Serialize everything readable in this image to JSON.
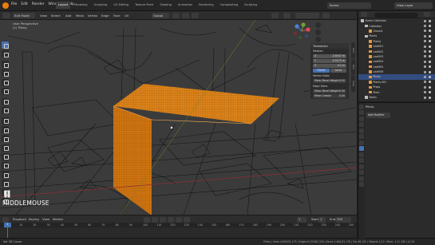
{
  "topbar": {
    "menus": [
      "File",
      "Edit",
      "Render",
      "Window",
      "Help"
    ],
    "tabs": [
      "Layout",
      "Modeling",
      "Sculpting",
      "UV Editing",
      "Texture Paint",
      "Shading",
      "Animation",
      "Rendering",
      "Compositing",
      "Scripting"
    ],
    "active_tab": "Layout",
    "scene_name": "Scene",
    "view_layer": "View Layer"
  },
  "viewport_header": {
    "mode": "Edit Mode",
    "menus": [
      "View",
      "Select",
      "Add",
      "Mesh",
      "Vertex",
      "Edge",
      "Face",
      "UV"
    ],
    "orientation": "Global",
    "view_title": "User Perspective",
    "object_name": "(1) Plinky"
  },
  "npanel": {
    "title": "Transform",
    "subtitle": "Median:",
    "rows": [
      {
        "label": "X",
        "value": "-0.6547 m"
      },
      {
        "label": "Y",
        "value": "-0.5275 m"
      },
      {
        "label": "Z",
        "value": "0.2 m"
      }
    ],
    "global_local": [
      "Global",
      "Local"
    ],
    "vertex_data": "Vertex Data:",
    "vertex_rows": [
      {
        "label": "Mean Bevel Weight",
        "value": "0.00"
      }
    ],
    "edge_data": "Edge Data:",
    "edge_rows": [
      {
        "label": "Mean Bevel Weight",
        "value": "0.00"
      },
      {
        "label": "Mean Crease",
        "value": "0.00"
      }
    ],
    "side_tabs": [
      "Item",
      "Tool",
      "View"
    ]
  },
  "keycast": {
    "text": "MIDDLEMOUSE"
  },
  "timeline": {
    "menus": [
      "Playback",
      "Keying",
      "View",
      "Marker"
    ],
    "current_frame": "1",
    "start_label": "Start",
    "start": "1",
    "end_label": "End",
    "end": "250",
    "ruler": [
      "1",
      "10",
      "20",
      "30",
      "40",
      "50",
      "60",
      "70",
      "80",
      "90",
      "100",
      "110",
      "120",
      "130",
      "140",
      "150",
      "160",
      "170",
      "180",
      "190",
      "200",
      "210",
      "220",
      "230",
      "240",
      "250"
    ]
  },
  "statusbar": {
    "left": "Set 3D Cursor",
    "right": "Plinky | Verts 4,899/31,179 | Edges 6,153/62,316 | Faces 2,484/31,176 | Tris 48,192 | Objects 1/12 | Mem: 1.21 GiB | v2.93"
  },
  "outliner": {
    "rows": [
      {
        "label": "Scene Collection",
        "type": "coll",
        "indent": 0
      },
      {
        "label": "Collection",
        "type": "coll",
        "indent": 1
      },
      {
        "label": "Ground",
        "type": "obj",
        "indent": 2
      },
      {
        "label": "Plants",
        "type": "coll",
        "indent": 1
      },
      {
        "label": "Plants",
        "type": "obj",
        "indent": 2
      },
      {
        "label": "Leaf001",
        "type": "obj",
        "indent": 2
      },
      {
        "label": "Leaf002",
        "type": "obj",
        "indent": 2
      },
      {
        "label": "Leaf003",
        "type": "obj",
        "indent": 2
      },
      {
        "label": "Leaf004",
        "type": "obj",
        "indent": 2
      },
      {
        "label": "Leaf005",
        "type": "obj",
        "indent": 2
      },
      {
        "label": "Leaf006",
        "type": "obj",
        "indent": 2
      },
      {
        "label": "Plinky",
        "type": "obj",
        "indent": 2,
        "selected": true
      },
      {
        "label": "Plants.001",
        "type": "obj",
        "indent": 2
      },
      {
        "label": "Props",
        "type": "obj",
        "indent": 2
      },
      {
        "label": "Plant",
        "type": "obj",
        "indent": 2
      },
      {
        "label": "Rocks",
        "type": "coll",
        "indent": 1
      }
    ]
  },
  "properties": {
    "object_name": "Plinky",
    "field": "Add Modifier"
  },
  "colors": {
    "selection": "#e8891a",
    "accent": "#4772b3",
    "wire": "#0c0c0c"
  }
}
